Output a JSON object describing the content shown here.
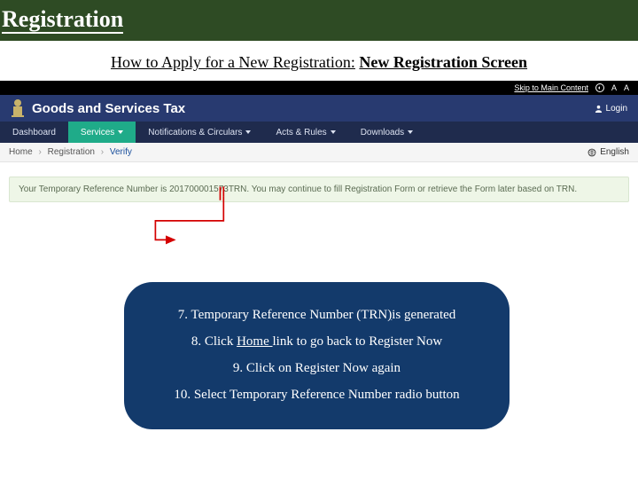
{
  "header": {
    "title": "Registration"
  },
  "subheading": {
    "prefix": "How to Apply for a New Registration:",
    "suffix": "New Registration Screen"
  },
  "topstrip": {
    "skip": "Skip to Main Content",
    "icon1": "◐",
    "a_plus": "A",
    "a_minus": "A"
  },
  "brand": {
    "title": "Goods and Services Tax",
    "login": "Login"
  },
  "menu": {
    "items": [
      {
        "label": "Dashboard",
        "caret": false
      },
      {
        "label": "Services",
        "caret": true,
        "active": true
      },
      {
        "label": "Notifications & Circulars",
        "caret": true
      },
      {
        "label": "Acts & Rules",
        "caret": true
      },
      {
        "label": "Downloads",
        "caret": true
      }
    ]
  },
  "breadcrumb": {
    "home": "Home",
    "reg": "Registration",
    "verify": "Verify",
    "lang": "English"
  },
  "alert": {
    "text": "Your Temporary Reference Number is 201700001573TRN. You may continue to fill Registration Form or retrieve the Form later based on TRN."
  },
  "callout": {
    "l1a": "7. Temporary Reference Number (TRN",
    "l1b": ")",
    "l1c": "is generated",
    "l2a": "8. Click ",
    "l2b": "Home ",
    "l2c": "link to go back to Register Now",
    "l3": "9. Click on Register Now again",
    "l4": "10. Select Temporary Reference Number radio button"
  }
}
